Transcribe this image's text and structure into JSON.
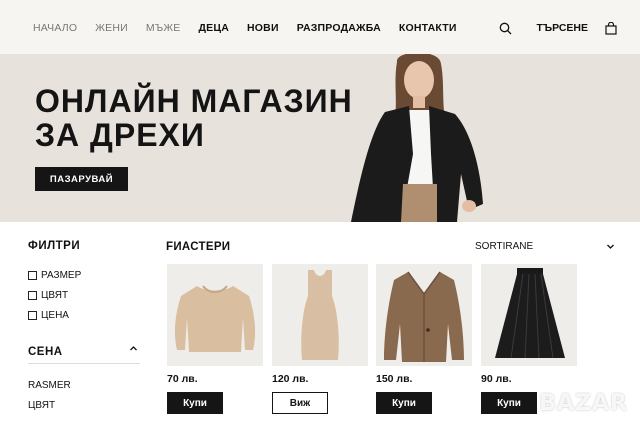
{
  "nav": {
    "links": [
      "НАЧАЛО",
      "ЖЕНИ",
      "МЪЖЕ",
      "ДЕЦА",
      "НОВИ",
      "РАЗПРОДАЖБА",
      "КОНТАКТИ"
    ],
    "search_label": "ТЪРСЕНЕ"
  },
  "hero": {
    "title_line1": "ОНЛАЙН МАГАЗИН",
    "title_line2": "ЗА ДРЕХИ",
    "cta": "ПАЗАРУВАЙ"
  },
  "sidebar": {
    "title": "ФИЛТРИ",
    "checks": [
      "РАЗМЕР",
      "ЦВЯТ",
      "ЦЕНА"
    ],
    "section_title": "СЕНА",
    "links": [
      "RASMER",
      "ЦВЯТ"
    ]
  },
  "products": {
    "title": "FИАСТЕРИ",
    "sort_label": "SORTIRANE",
    "items": [
      {
        "name": "sweater",
        "price": "70 лв.",
        "button": "Купи",
        "style": "dark"
      },
      {
        "name": "dress",
        "price": "120 лв.",
        "button": "Виж",
        "style": "light"
      },
      {
        "name": "blazer",
        "price": "150 лв.",
        "button": "Купи",
        "style": "dark"
      },
      {
        "name": "skirt",
        "price": "90 лв.",
        "button": "Купи",
        "style": "dark"
      }
    ]
  },
  "watermark": "BAZAR",
  "colors": {
    "hero_bg": "#e8e2dc",
    "nav_bg": "#f7f5f2",
    "button_dark": "#151515",
    "card_bg": "#efedea"
  }
}
